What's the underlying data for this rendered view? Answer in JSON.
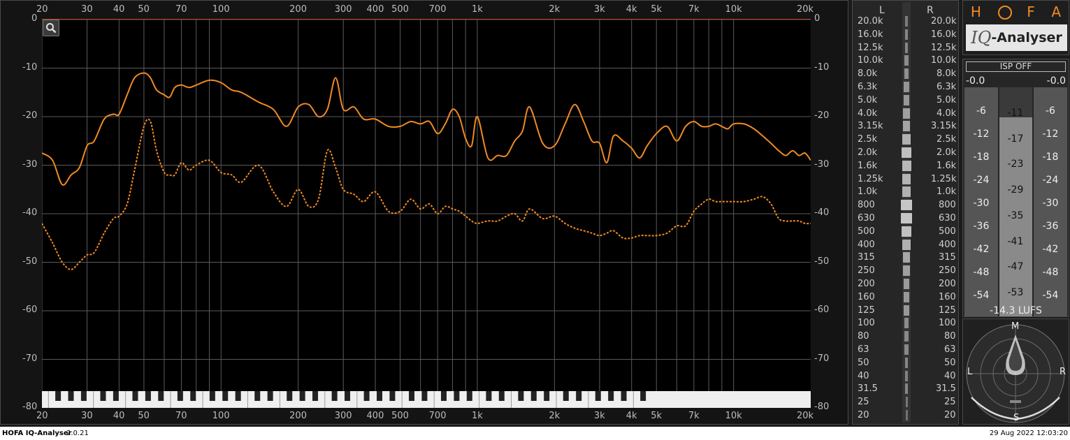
{
  "spectrum": {
    "freq_labels": [
      "20",
      "30",
      "40",
      "50",
      "70",
      "100",
      "200",
      "300",
      "400",
      "500",
      "700",
      "1k",
      "2k",
      "3k",
      "4k",
      "5k",
      "7k",
      "10k",
      "20k"
    ],
    "freq_values": [
      20,
      30,
      40,
      50,
      70,
      100,
      200,
      300,
      400,
      500,
      700,
      1000,
      2000,
      3000,
      4000,
      5000,
      7000,
      10000,
      20000
    ],
    "db_labels": [
      "0",
      "-10",
      "-20",
      "-30",
      "-40",
      "-50",
      "-60",
      "-70",
      "-80"
    ],
    "db_values": [
      0,
      -10,
      -20,
      -30,
      -40,
      -50,
      -60,
      -70,
      -80
    ],
    "peak_color": "#f08a24",
    "avg_color": "#f08a24",
    "zoom_icon": "magnifier-icon"
  },
  "chart_data": {
    "type": "line",
    "x_scale": "log",
    "xlim": [
      20,
      20000
    ],
    "ylim": [
      -80,
      0
    ],
    "grid": true,
    "series": [
      {
        "style": "solid",
        "x": [
          20,
          22,
          24,
          26,
          28,
          30,
          32,
          35,
          38,
          40,
          43,
          46,
          50,
          53,
          56,
          60,
          63,
          66,
          70,
          75,
          80,
          90,
          100,
          110,
          120,
          140,
          160,
          180,
          200,
          220,
          240,
          260,
          280,
          300,
          330,
          360,
          400,
          450,
          500,
          550,
          600,
          650,
          700,
          750,
          800,
          850,
          900,
          950,
          1000,
          1100,
          1200,
          1300,
          1400,
          1500,
          1600,
          1800,
          2000,
          2200,
          2400,
          2600,
          2800,
          3000,
          3200,
          3400,
          3700,
          4000,
          4300,
          4600,
          5000,
          5500,
          6000,
          6500,
          7000,
          7500,
          8000,
          8500,
          9000,
          9500,
          10000,
          11000,
          12000,
          13000,
          14000,
          15000,
          16000,
          17000,
          18000,
          19000,
          20000
        ],
        "y": [
          -27.5,
          -29,
          -34,
          -32,
          -30.5,
          -26,
          -25,
          -20.5,
          -19.5,
          -19.5,
          -15.5,
          -12,
          -11,
          -12,
          -14.5,
          -15.5,
          -16,
          -14,
          -13.5,
          -14,
          -13.5,
          -12.5,
          -13,
          -14.5,
          -15,
          -17,
          -18.5,
          -22,
          -18,
          -17.5,
          -20,
          -18.5,
          -12,
          -18.5,
          -18,
          -20.5,
          -20.5,
          -22,
          -22,
          -21,
          -21.5,
          -21,
          -23.5,
          -21.5,
          -18.5,
          -20,
          -24.5,
          -26,
          -20,
          -28.5,
          -28,
          -28,
          -25,
          -23,
          -18,
          -25.5,
          -26,
          -21.5,
          -17.5,
          -21,
          -25,
          -25.5,
          -29.5,
          -24,
          -25,
          -26.5,
          -28.5,
          -26,
          -23.5,
          -22,
          -25,
          -22,
          -21,
          -22,
          -22,
          -21.5,
          -22,
          -22.5,
          -21.5,
          -21.5,
          -22.5,
          -24,
          -25.5,
          -27,
          -28,
          -27,
          -28,
          -27.5,
          -29
        ]
      },
      {
        "style": "dashed",
        "x": [
          20,
          22,
          24,
          26,
          28,
          30,
          32,
          35,
          38,
          40,
          43,
          46,
          50,
          53,
          56,
          60,
          63,
          66,
          70,
          75,
          80,
          90,
          100,
          110,
          120,
          140,
          160,
          180,
          200,
          220,
          240,
          260,
          280,
          300,
          330,
          360,
          400,
          450,
          500,
          550,
          600,
          650,
          700,
          750,
          800,
          850,
          900,
          950,
          1000,
          1100,
          1200,
          1300,
          1400,
          1500,
          1600,
          1800,
          2000,
          2200,
          2400,
          2600,
          2800,
          3000,
          3200,
          3400,
          3700,
          4000,
          4300,
          4600,
          5000,
          5500,
          6000,
          6500,
          7000,
          7500,
          8000,
          8500,
          9000,
          9500,
          10000,
          11000,
          12000,
          13000,
          14000,
          15000,
          16000,
          17000,
          18000,
          19000,
          20000
        ],
        "y": [
          -42,
          -46,
          -50,
          -51.5,
          -50,
          -48.5,
          -48,
          -44,
          -41,
          -40.5,
          -38,
          -31,
          -22,
          -21,
          -27,
          -31.5,
          -32,
          -32,
          -29.5,
          -31,
          -30,
          -29,
          -31.5,
          -32,
          -33.5,
          -30,
          -35.5,
          -38.5,
          -35,
          -38.5,
          -37,
          -27,
          -30.5,
          -35,
          -36,
          -37.5,
          -35.5,
          -39.5,
          -39.5,
          -37,
          -39,
          -38,
          -40,
          -38.5,
          -39,
          -39.5,
          -40.5,
          -41.5,
          -42,
          -41.5,
          -41.5,
          -40.5,
          -40,
          -41.5,
          -39,
          -41,
          -40.5,
          -42,
          -43,
          -43.5,
          -44,
          -44.5,
          -44,
          -43.5,
          -45,
          -45,
          -44.5,
          -44.5,
          -44.5,
          -44,
          -42.5,
          -42.5,
          -39.5,
          -38,
          -37,
          -37.5,
          -37.5,
          -37.5,
          -37.5,
          -37.5,
          -37,
          -36.5,
          -38,
          -41,
          -41.5,
          -41.5,
          -41.5,
          -42,
          -42
        ]
      }
    ]
  },
  "third_octave": {
    "header_left": "L",
    "header_right": "R",
    "bands": [
      "20.0k",
      "16.0k",
      "12.5k",
      "10.0k",
      "8.0k",
      "6.3k",
      "5.0k",
      "4.0k",
      "3.15k",
      "2.5k",
      "2.0k",
      "1.6k",
      "1.25k",
      "1.0k",
      "800",
      "630",
      "500",
      "400",
      "315",
      "250",
      "200",
      "160",
      "125",
      "100",
      "80",
      "63",
      "50",
      "40",
      "31.5",
      "25",
      "20"
    ],
    "levels": [
      0.12,
      0.18,
      0.18,
      0.22,
      0.25,
      0.28,
      0.3,
      0.35,
      0.38,
      0.45,
      0.55,
      0.5,
      0.48,
      0.45,
      0.6,
      0.6,
      0.55,
      0.45,
      0.4,
      0.35,
      0.32,
      0.3,
      0.3,
      0.22,
      0.2,
      0.2,
      0.18,
      0.15,
      0.18,
      0.08,
      0.05
    ]
  },
  "logo": {
    "letters": [
      "H",
      "O",
      "F",
      "A"
    ],
    "product_italic": "IQ",
    "product_rest": "-Analyser"
  },
  "meter": {
    "isp_label": "ISP OFF",
    "peak_left": "-0.0",
    "peak_right": "-0.0",
    "side_scale": [
      "-6",
      "-12",
      "-18",
      "-24",
      "-30",
      "-36",
      "-42",
      "-48",
      "-54"
    ],
    "center_scale": [
      "-11",
      "-17",
      "-23",
      "-29",
      "-35",
      "-41",
      "-47",
      "-53"
    ],
    "lufs": "-14.3 LUFS",
    "level_fraction": 0.87
  },
  "goniometer": {
    "m": "M",
    "s": "S",
    "l": "L",
    "r": "R"
  },
  "footer": {
    "app_name": "HOFA IQ-Analyser",
    "version": "2.0.21",
    "timestamp": "29 Aug 2022 12:03:20"
  }
}
